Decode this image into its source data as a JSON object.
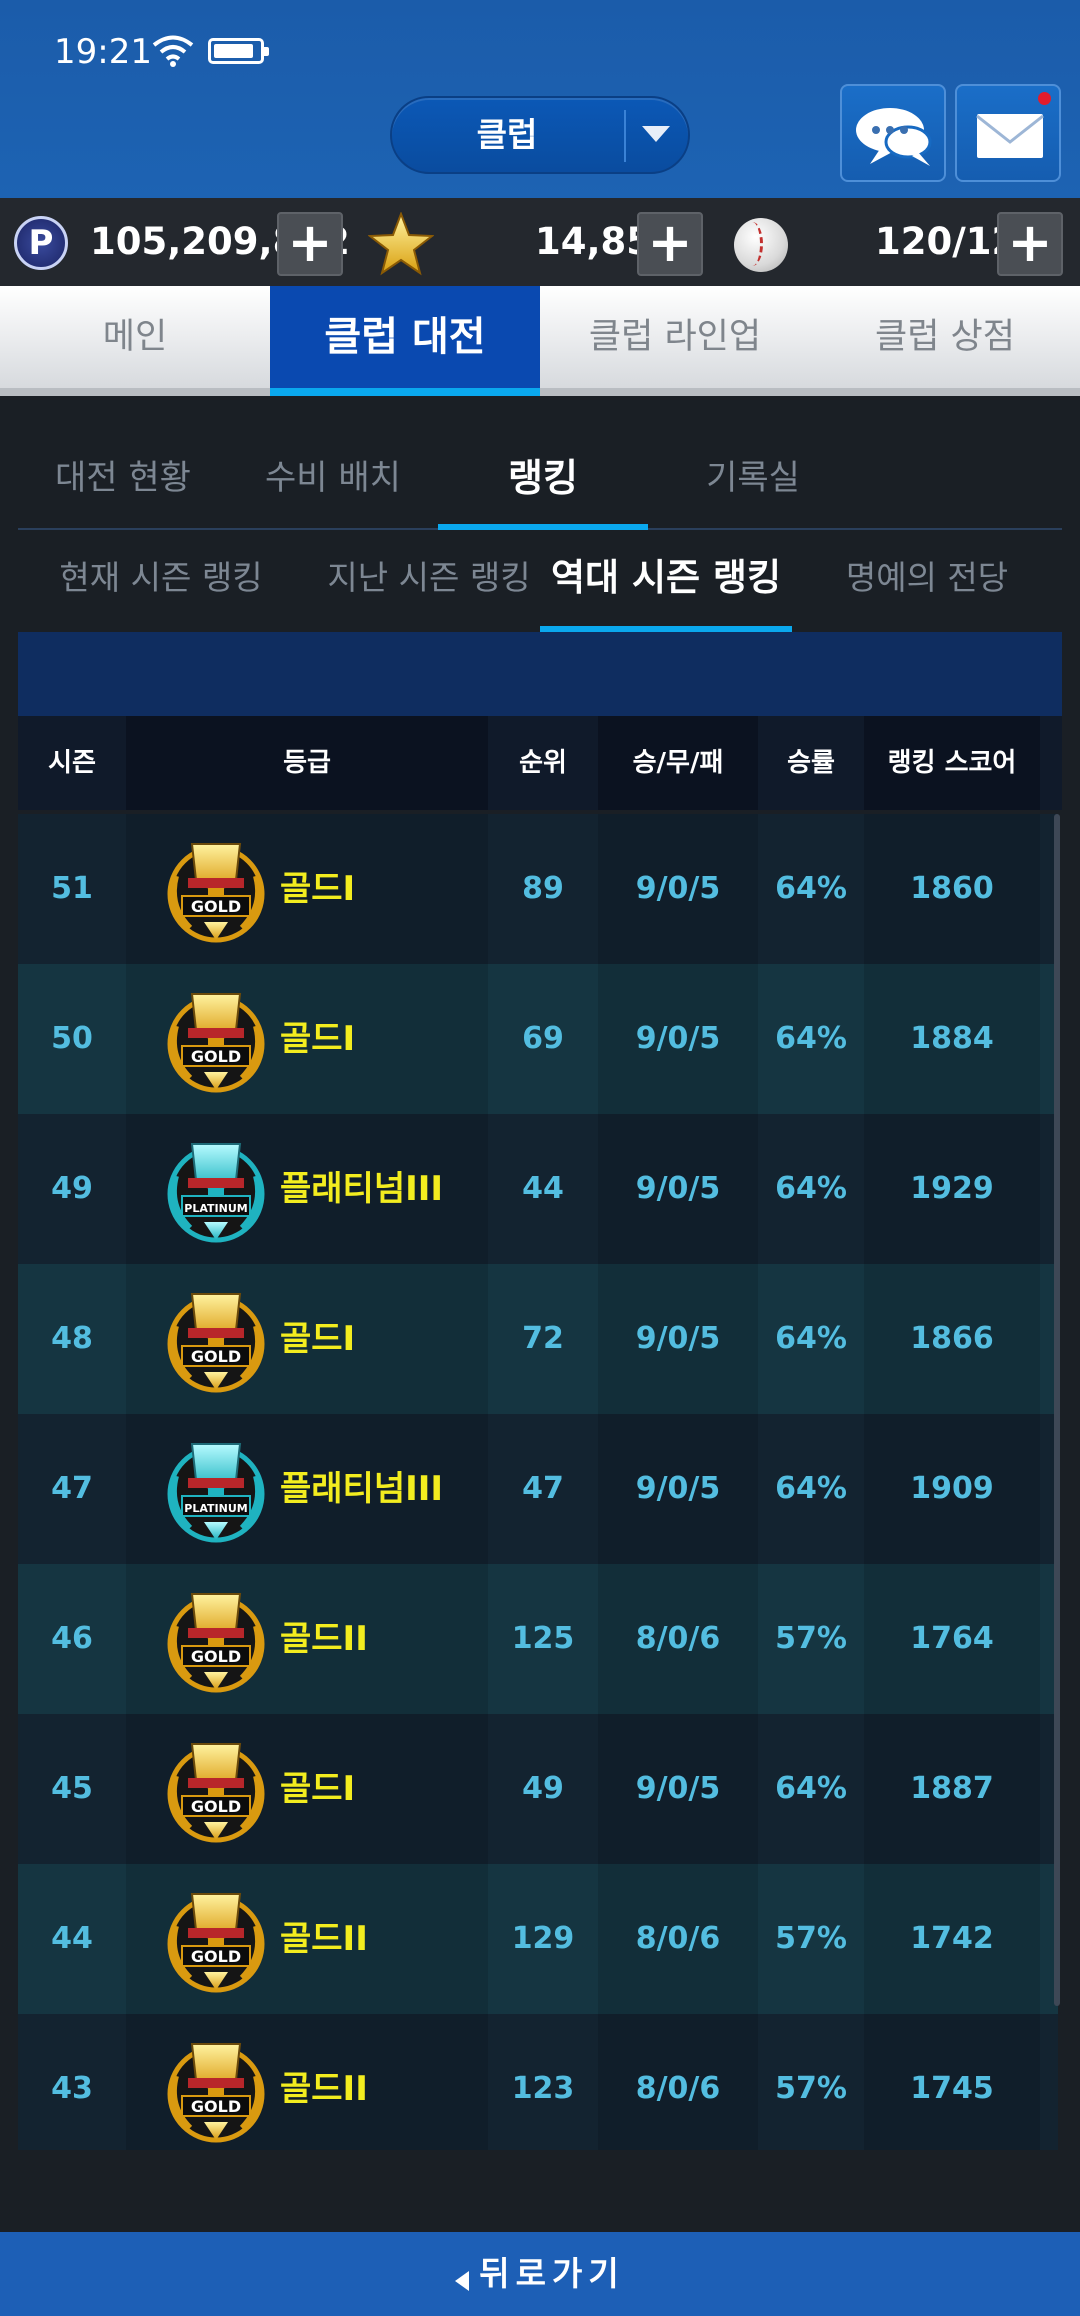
{
  "status_bar": {
    "time": "19:21"
  },
  "header": {
    "club_label": "클럽"
  },
  "currency": {
    "points": "105,209,802",
    "stars": "14,859",
    "balls": "120/120",
    "plus": "+",
    "p_symbol": "P"
  },
  "main_tabs": [
    {
      "label": "메인",
      "active": false
    },
    {
      "label": "클럽 대전",
      "active": true
    },
    {
      "label": "클럽 라인업",
      "active": false
    },
    {
      "label": "클럽 상점",
      "active": false
    }
  ],
  "sub_tabs": [
    {
      "label": "대전 현황",
      "active": false
    },
    {
      "label": "수비 배치",
      "active": false
    },
    {
      "label": "랭킹",
      "active": true
    },
    {
      "label": "기록실",
      "active": false
    }
  ],
  "ranking_tabs": [
    {
      "label": "현재 시즌 랭킹",
      "active": false
    },
    {
      "label": "지난 시즌 랭킹",
      "active": false
    },
    {
      "label": "역대 시즌 랭킹",
      "active": true
    },
    {
      "label": "명예의 전당",
      "active": false
    }
  ],
  "table": {
    "columns": [
      "시즌",
      "등급",
      "순위",
      "승/무/패",
      "승률",
      "랭킹 스코어"
    ],
    "rows": [
      {
        "season": "51",
        "tier": "gold",
        "badge": "GOLD",
        "grade": "골드I",
        "rank": "89",
        "record": "9/0/5",
        "rate": "64%",
        "score": "1860"
      },
      {
        "season": "50",
        "tier": "gold",
        "badge": "GOLD",
        "grade": "골드I",
        "rank": "69",
        "record": "9/0/5",
        "rate": "64%",
        "score": "1884"
      },
      {
        "season": "49",
        "tier": "platinum",
        "badge": "PLATINUM",
        "grade": "플래티넘III",
        "rank": "44",
        "record": "9/0/5",
        "rate": "64%",
        "score": "1929"
      },
      {
        "season": "48",
        "tier": "gold",
        "badge": "GOLD",
        "grade": "골드I",
        "rank": "72",
        "record": "9/0/5",
        "rate": "64%",
        "score": "1866"
      },
      {
        "season": "47",
        "tier": "platinum",
        "badge": "PLATINUM",
        "grade": "플래티넘III",
        "rank": "47",
        "record": "9/0/5",
        "rate": "64%",
        "score": "1909"
      },
      {
        "season": "46",
        "tier": "gold",
        "badge": "GOLD",
        "grade": "골드II",
        "rank": "125",
        "record": "8/0/6",
        "rate": "57%",
        "score": "1764"
      },
      {
        "season": "45",
        "tier": "gold",
        "badge": "GOLD",
        "grade": "골드I",
        "rank": "49",
        "record": "9/0/5",
        "rate": "64%",
        "score": "1887"
      },
      {
        "season": "44",
        "tier": "gold",
        "badge": "GOLD",
        "grade": "골드II",
        "rank": "129",
        "record": "8/0/6",
        "rate": "57%",
        "score": "1742"
      },
      {
        "season": "43",
        "tier": "gold",
        "badge": "GOLD",
        "grade": "골드II",
        "rank": "123",
        "record": "8/0/6",
        "rate": "57%",
        "score": "1745"
      }
    ]
  },
  "footer": {
    "back_label": "뒤로가기"
  },
  "colors": {
    "accent": "#0aa8ee",
    "header_blue": "#1d63b3",
    "value_cyan": "#53bde0",
    "grade_yellow": "#f3ed1f"
  }
}
